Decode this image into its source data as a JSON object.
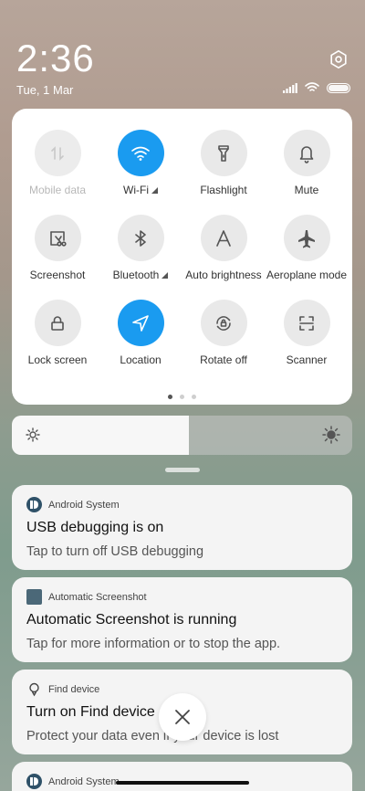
{
  "status": {
    "time": "2:36",
    "date": "Tue, 1 Mar"
  },
  "quick_settings": {
    "tiles": [
      {
        "label": "Mobile data",
        "icon": "mobile-data-icon",
        "active": false,
        "disabled": true
      },
      {
        "label": "Wi-Fi",
        "icon": "wifi-icon",
        "active": true,
        "signal": true
      },
      {
        "label": "Flashlight",
        "icon": "flashlight-icon",
        "active": false
      },
      {
        "label": "Mute",
        "icon": "bell-icon",
        "active": false
      },
      {
        "label": "Screenshot",
        "icon": "screenshot-icon",
        "active": false
      },
      {
        "label": "Bluetooth",
        "icon": "bluetooth-icon",
        "active": false,
        "signal": true
      },
      {
        "label": "Auto brightness",
        "icon": "auto-brightness-icon",
        "active": false
      },
      {
        "label": "Aeroplane mode",
        "icon": "airplane-icon",
        "active": false
      },
      {
        "label": "Lock screen",
        "icon": "lock-icon",
        "active": false
      },
      {
        "label": "Location",
        "icon": "location-icon",
        "active": true
      },
      {
        "label": "Rotate off",
        "icon": "rotate-icon",
        "active": false
      },
      {
        "label": "Scanner",
        "icon": "scanner-icon",
        "active": false
      }
    ],
    "page_count": 3,
    "current_page": 1
  },
  "brightness": {
    "level": 0.52
  },
  "notifications": [
    {
      "app": "Android System",
      "title": "USB debugging is on",
      "body": "Tap to turn off USB debugging"
    },
    {
      "app": "Automatic Screenshot",
      "title": "Automatic Screenshot is running",
      "body": "Tap for more information or to stop the app."
    },
    {
      "app": "Find device",
      "title": "Turn on Find device",
      "body": "Protect your data even if your device is lost"
    },
    {
      "app": "Android System",
      "title": "",
      "body": ""
    }
  ],
  "colors": {
    "accent": "#1a9bf0",
    "tile_inactive": "#e9e9e9"
  }
}
